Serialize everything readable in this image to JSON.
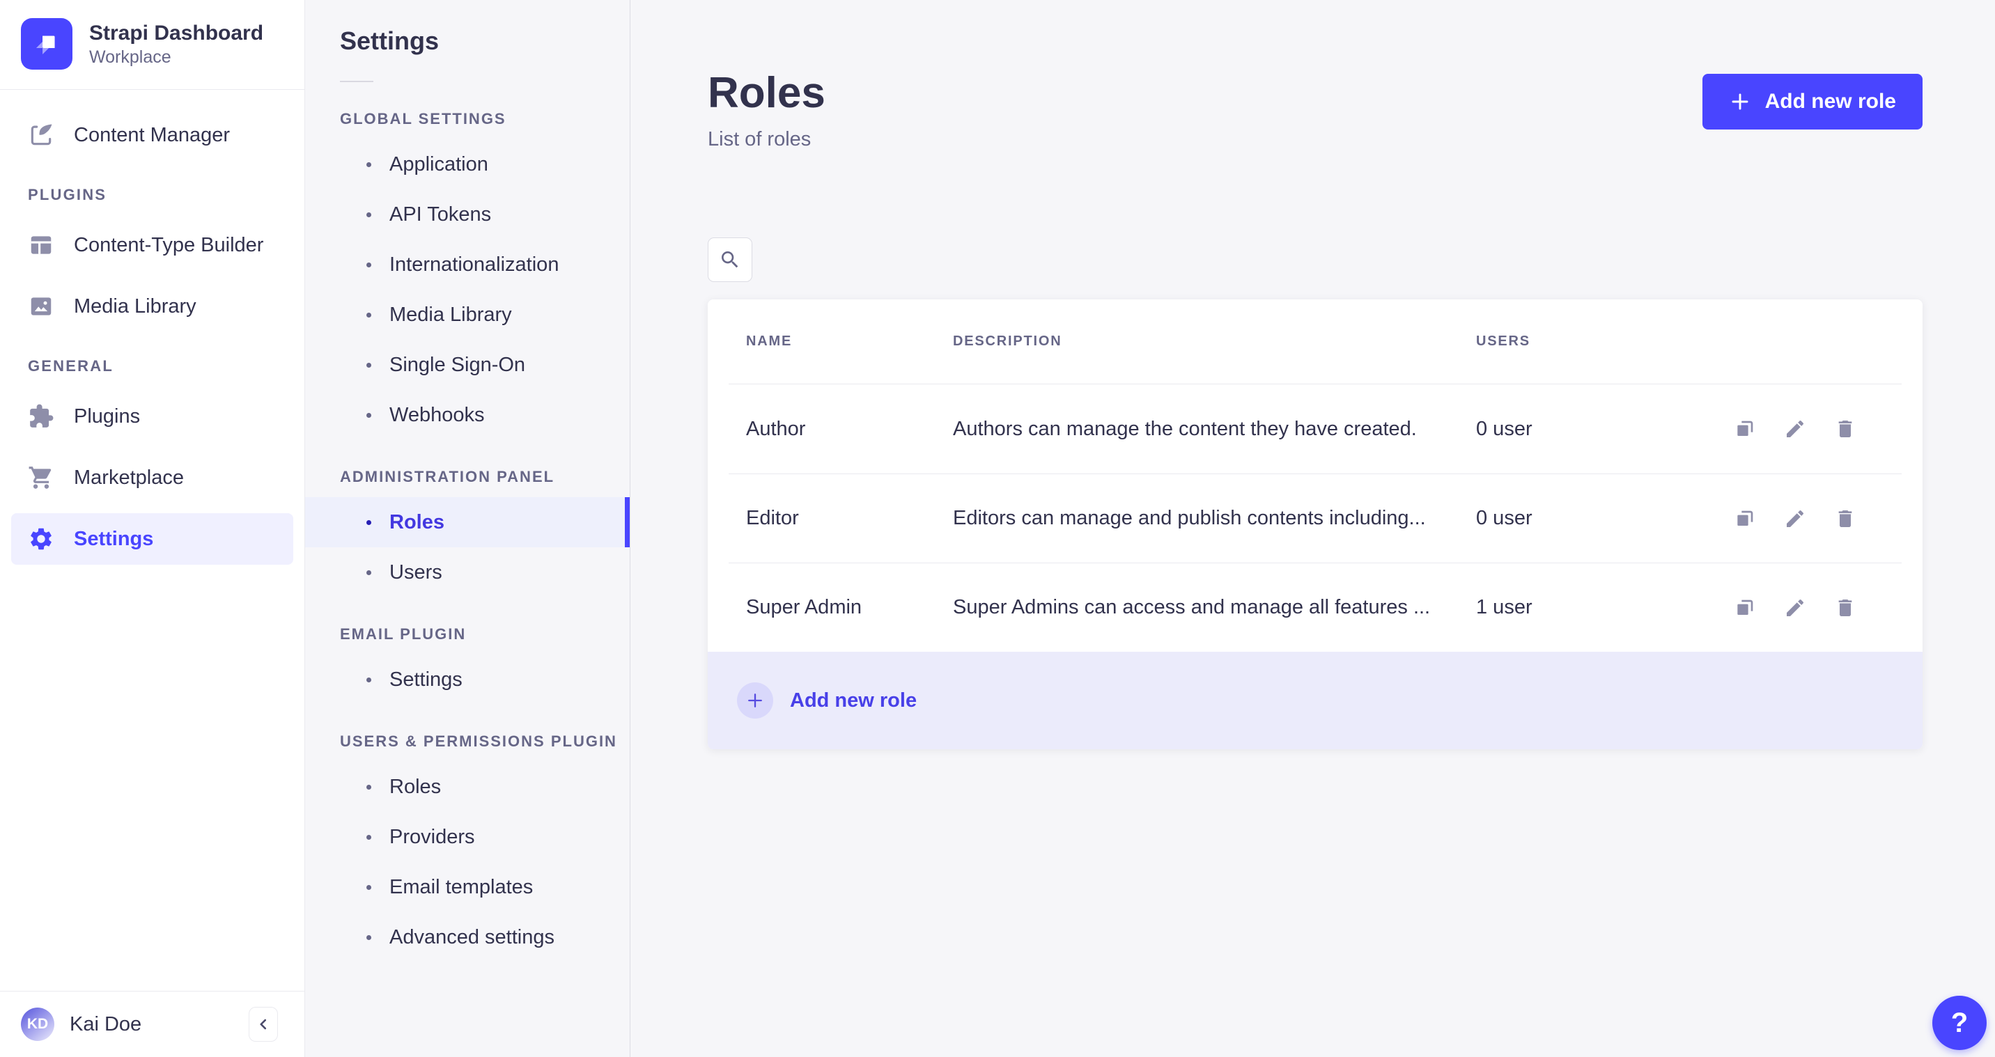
{
  "brand": {
    "title": "Strapi Dashboard",
    "subtitle": "Workplace"
  },
  "colors": {
    "primary": "#4945ff",
    "primary_light": "#f0f0ff",
    "text": "#32324d",
    "muted": "#666687"
  },
  "sidebar": {
    "content_manager": "Content Manager",
    "plugins_header": "PLUGINS",
    "content_type_builder": "Content-Type Builder",
    "media_library": "Media Library",
    "general_header": "GENERAL",
    "plugins": "Plugins",
    "marketplace": "Marketplace",
    "settings": "Settings",
    "user": {
      "initials": "KD",
      "name": "Kai Doe"
    },
    "collapse_icon": "chevron-left"
  },
  "subnav": {
    "title": "Settings",
    "sections": [
      {
        "label": "GLOBAL SETTINGS",
        "items": [
          "Application",
          "API Tokens",
          "Internationalization",
          "Media Library",
          "Single Sign-On",
          "Webhooks"
        ]
      },
      {
        "label": "ADMINISTRATION PANEL",
        "items": [
          "Roles",
          "Users"
        ],
        "active_item": "Roles"
      },
      {
        "label": "EMAIL PLUGIN",
        "items": [
          "Settings"
        ]
      },
      {
        "label": "USERS & PERMISSIONS PLUGIN",
        "items": [
          "Roles",
          "Providers",
          "Email templates",
          "Advanced settings"
        ]
      }
    ]
  },
  "page": {
    "title": "Roles",
    "subtitle": "List of roles",
    "add_button": "Add new role"
  },
  "table": {
    "headers": {
      "name": "NAME",
      "description": "DESCRIPTION",
      "users": "USERS"
    },
    "rows": [
      {
        "name": "Author",
        "description": "Authors can manage the content they have created.",
        "users": "0 user"
      },
      {
        "name": "Editor",
        "description": "Editors can manage and publish contents including...",
        "users": "0 user"
      },
      {
        "name": "Super Admin",
        "description": "Super Admins can access and manage all features ...",
        "users": "1 user"
      }
    ],
    "footer_add": "Add new role"
  },
  "help": {
    "label": "?"
  }
}
